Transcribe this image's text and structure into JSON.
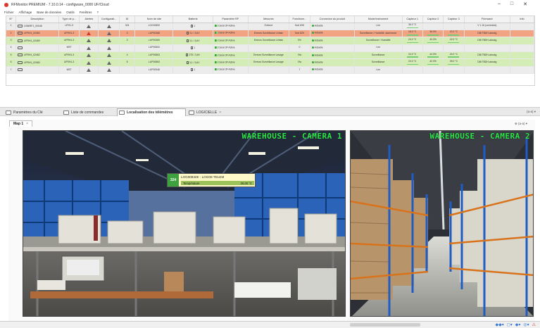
{
  "window": {
    "title": "RFMonitor PREMIUM - 7.10.0.14 - configware_0000 UF/Cloud",
    "controls": [
      "–",
      "□",
      "✕"
    ]
  },
  "menu": [
    "Fichier",
    "Affichage",
    "Base de données",
    "Outils",
    "Fenêtres",
    "?"
  ],
  "grid": {
    "columns": [
      "N°",
      "Description",
      "Type de p...",
      "Alertes",
      "Configurati...",
      "ID",
      "Nom de site",
      "Batterie",
      "Paramètre RF",
      "Mesures",
      "Fonctionn...",
      "Connexion du produit",
      "Mode/Instrument",
      "Capteur 1",
      "Capteur 2",
      "Capteur 3",
      "Firmware",
      "Info"
    ],
    "rows": [
      {
        "num": "1",
        "desc": "USB/RF1_00048",
        "type": "UFH1-3",
        "alert": "grey",
        "conf": "",
        "id": "324",
        "site": "LOG00832",
        "batt": "1",
        "rf": "Canal 3F Active",
        "mes": "Enforcé",
        "fonc": "Noir 835",
        "conn": "Actuelle",
        "mode": "Lire",
        "c1": "36.0 °C",
        "c2": "",
        "c3": "",
        "fw": "V 1.16 (corrected)",
        "info": "",
        "cls": "w"
      },
      {
        "num": "2",
        "desc": "UFRH1_02460",
        "type": "UFRH1-3",
        "alert": "red",
        "conf": "",
        "id": "3",
        "site": "LUP00368",
        "batt": "3,1 / 3,6V",
        "rf": "Canal 3F Active",
        "mes": "Erreurs Surveillance Urbain",
        "fonc": "Noir 825",
        "conn": "Actuelle",
        "mode": "Surveillance / Humidité, alarmance",
        "c1": "18.0 °C",
        "c2": "36.0%",
        "c3": "22.0 °C",
        "fw": "DBl TBDH-aboutg",
        "info": "",
        "cls": "sel"
      },
      {
        "num": "3",
        "desc": "UFRH1_02469",
        "type": "UFRH1-3",
        "alert": "grey",
        "conf": "",
        "id": "3",
        "site": "LUP00369",
        "batt": "3,1 / 3,6V",
        "rf": "Canal 3F Active",
        "mes": "Erreurs Surveillance Urbain",
        "fonc": "0%",
        "conn": "Actuelle",
        "mode": "Surveillance / Humidité",
        "c1": "24.0 °C",
        "c2": "40.0%",
        "c3": "22.0 °C",
        "fw": "DBl TBDH-aboutg",
        "info": "",
        "cls": "g"
      },
      {
        "num": "4",
        "desc": "",
        "type": "MST",
        "alert": "grey",
        "conf": "",
        "id": "",
        "site": "LUP00800",
        "batt": "1",
        "rf": "Canal 3F Active",
        "mes": "",
        "fonc": "0",
        "conn": "Actuelle",
        "mode": "Lire",
        "c1": "",
        "c2": "",
        "c3": "",
        "fw": "",
        "info": "",
        "cls": "w"
      },
      {
        "num": "5",
        "desc": "UFRH1_02482",
        "type": "UFRH1-3",
        "alert": "grey",
        "conf": "",
        "id": "4",
        "site": "LUP00863",
        "batt": "275 / 3,6V",
        "rf": "Canal 3F Active",
        "mes": "Erreurs Surveillance Lavage",
        "fonc": "Vfa",
        "conn": "Actuelle",
        "mode": "Surveillance",
        "c1": "24.0 °C",
        "c2": "44.0%",
        "c3": "24.0 °C",
        "fw": "DBl TBDH-aboutg",
        "info": "",
        "cls": "g"
      },
      {
        "num": "6",
        "desc": "UFRH1_02480",
        "type": "UFRH1-3",
        "alert": "grey",
        "conf": "",
        "id": "5",
        "site": "LUP00863",
        "batt": "3,1 / 3,6V",
        "rf": "Canal 3F Active",
        "mes": "Erreurs Surveillance Lavage",
        "fonc": "Vfa",
        "conn": "Actuelle",
        "mode": "Surveillance",
        "c1": "24.0 °C",
        "c2": "42.0%",
        "c3": "25.0 °C",
        "fw": "DBl TBDH-aboutg",
        "info": "",
        "cls": "g"
      },
      {
        "num": "7",
        "desc": "",
        "type": "MST",
        "alert": "grey",
        "conf": "",
        "id": "",
        "site": "LUP00948",
        "batt": "1",
        "rf": "Canal 3F Active",
        "mes": "",
        "fonc": "7",
        "conn": "Actuelle",
        "mode": "Lire",
        "c1": "",
        "c2": "",
        "c3": "",
        "fw": "",
        "info": "",
        "cls": "w"
      }
    ]
  },
  "tabs": [
    {
      "label": "Paramètres du Clé",
      "active": false
    },
    {
      "label": "Liste de commandes",
      "active": false
    },
    {
      "label": "Localisation des télémètres",
      "active": true
    },
    {
      "label": "LOGICIELLE",
      "active": false
    }
  ],
  "tabbar_menu": "(a-a) ▾",
  "map": {
    "tab_label": "Map 1",
    "zoom_label": "⊕ (a-a) ▾",
    "camera1_label": "WAREHOUSE - CAMERA 1",
    "camera2_label": "WAREHOUSE - CAMERA 2"
  },
  "tag": {
    "number": "324",
    "name": "LOG00832E - LOG00-TELEM",
    "measure": "Température",
    "value": "26.00 °C"
  },
  "status_icons": [
    "◆◆▾",
    "◻▾",
    "◆▾",
    "◎▾",
    "⚠"
  ],
  "colors": {
    "row_ok": "#d4ecb5",
    "row_selected": "#f2a382",
    "camera_label": "#2ee84a",
    "tag_badge": "#3da13d"
  }
}
